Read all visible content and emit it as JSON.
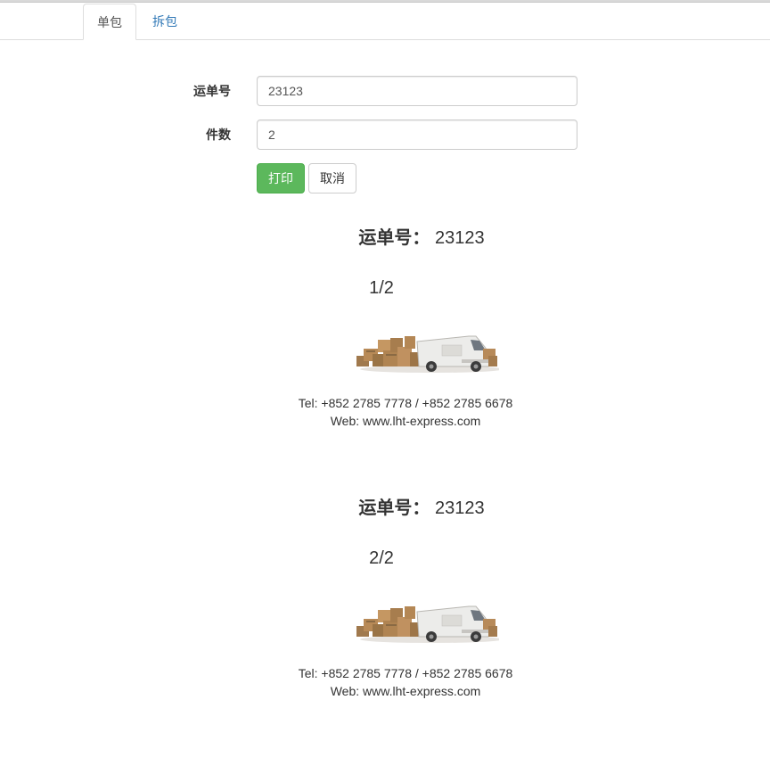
{
  "tabs": [
    {
      "label": "单包",
      "active": true
    },
    {
      "label": "拆包",
      "active": false
    }
  ],
  "form": {
    "waybill_label": "运单号",
    "waybill_value": "23123",
    "pieces_label": "件数",
    "pieces_value": "2"
  },
  "buttons": {
    "print": "打印",
    "cancel": "取消"
  },
  "labels": [
    {
      "title_key": "运单号：",
      "title_value": "23123",
      "count": "1/2",
      "tel": "Tel: +852 2785 7778 / +852 2785 6678",
      "web": "Web: www.lht-express.com"
    },
    {
      "title_key": "运单号：",
      "title_value": "23123",
      "count": "2/2",
      "tel": "Tel: +852 2785 7778 / +852 2785 6678",
      "web": "Web: www.lht-express.com"
    }
  ],
  "colors": {
    "tab_link": "#337ab7",
    "print_button": "#5cb85c",
    "text": "#333333"
  },
  "icons": {
    "label_graphic": "delivery-truck-with-boxes-icon"
  }
}
